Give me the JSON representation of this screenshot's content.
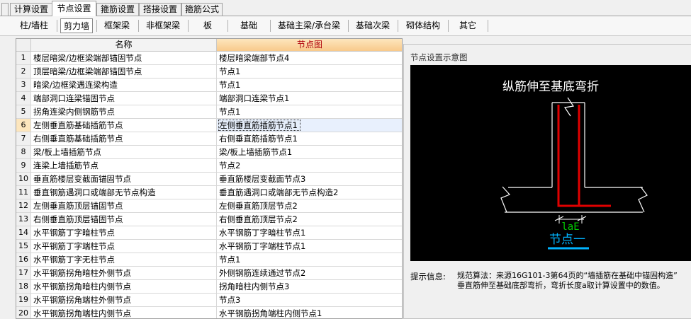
{
  "tabs": [
    {
      "label": "计算设置"
    },
    {
      "label": "节点设置"
    },
    {
      "label": "箍筋设置"
    },
    {
      "label": "搭接设置"
    },
    {
      "label": "箍筋公式"
    }
  ],
  "toolbar": [
    {
      "label": "柱/墙柱"
    },
    {
      "label": "剪力墙"
    },
    {
      "label": "框架梁"
    },
    {
      "label": "非框架梁"
    },
    {
      "label": "板"
    },
    {
      "label": "基础"
    },
    {
      "label": "基础主梁/承台梁"
    },
    {
      "label": "基础次梁"
    },
    {
      "label": "砌体结构"
    },
    {
      "label": "其它"
    }
  ],
  "table": {
    "columns": [
      "名称",
      "节点图"
    ],
    "selected_row": 6,
    "rows": [
      {
        "num": "1",
        "name": "楼层暗梁/边框梁端部锚固节点",
        "node": "楼层暗梁端部节点4"
      },
      {
        "num": "2",
        "name": "顶层暗梁/边框梁端部锚固节点",
        "node": "节点1"
      },
      {
        "num": "3",
        "name": "暗梁/边框梁遇连梁构造",
        "node": "节点1"
      },
      {
        "num": "4",
        "name": "端部洞口连梁锚固节点",
        "node": "端部洞口连梁节点1"
      },
      {
        "num": "5",
        "name": "拐角连梁内侧钢筋节点",
        "node": "节点1"
      },
      {
        "num": "6",
        "name": "左侧垂直筋基础插筋节点",
        "node": "左侧垂直筋插筋节点1"
      },
      {
        "num": "7",
        "name": "右侧垂直筋基础插筋节点",
        "node": "右侧垂直筋插筋节点1"
      },
      {
        "num": "8",
        "name": "梁/板上墙插筋节点",
        "node": "梁/板上墙插筋节点1"
      },
      {
        "num": "9",
        "name": "连梁上墙插筋节点",
        "node": "节点2"
      },
      {
        "num": "10",
        "name": "垂直筋楼层变截面锚固节点",
        "node": "垂直筋楼层变截面节点3"
      },
      {
        "num": "11",
        "name": "垂直钢筋遇洞口或端部无节点构造",
        "node": "垂直筋遇洞口或端部无节点构造2"
      },
      {
        "num": "12",
        "name": "左侧垂直筋顶层锚固节点",
        "node": "左侧垂直筋顶层节点2"
      },
      {
        "num": "13",
        "name": "右侧垂直筋顶层锚固节点",
        "node": "右侧垂直筋顶层节点2"
      },
      {
        "num": "14",
        "name": "水平钢筋丁字暗柱节点",
        "node": "水平钢筋丁字暗柱节点1"
      },
      {
        "num": "15",
        "name": "水平钢筋丁字端柱节点",
        "node": "水平钢筋丁字端柱节点1"
      },
      {
        "num": "16",
        "name": "水平钢筋丁字无柱节点",
        "node": "节点1"
      },
      {
        "num": "17",
        "name": "水平钢筋拐角暗柱外侧节点",
        "node": "外侧钢筋连续通过节点2"
      },
      {
        "num": "18",
        "name": "水平钢筋拐角暗柱内侧节点",
        "node": "拐角暗柱内侧节点3"
      },
      {
        "num": "19",
        "name": "水平钢筋拐角端柱外侧节点",
        "node": "节点3"
      },
      {
        "num": "20",
        "name": "水平钢筋拐角端柱内侧节点",
        "node": "水平钢筋拐角端柱内侧节点1"
      }
    ]
  },
  "panel": {
    "title": "节点设置示意图",
    "diagram": {
      "caption": "纵筋伸至基底弯折",
      "dimension_label": "laE",
      "node_label": "节点一",
      "colors": {
        "background": "#000000",
        "outline": "#ffffff",
        "rebar": "#e00000",
        "dimension": "#00cc00",
        "node_label": "#00b4ff"
      }
    },
    "hint_label": "提示信息:",
    "hint_lines": [
      "规范算法：来源16G101-3第64页的“墙插筋在基础中锚固构造”",
      "垂直筋伸至基础底部弯折，弯折长度a取计算设置中的数值。"
    ]
  }
}
